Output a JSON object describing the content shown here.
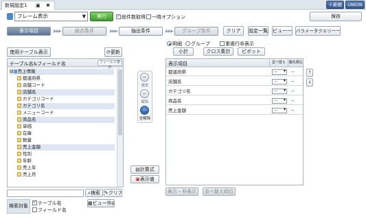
{
  "top_tab": {
    "label": "新規設定1"
  },
  "top_buttons": {
    "new": "＋新規",
    "union": "UNION"
  },
  "toolbar": {
    "view_select": "フレーム表示",
    "run": "実行",
    "total_count": "総件数取得",
    "temp_option": "一時オプション",
    "save": "保存"
  },
  "steps": {
    "display": "表示項目",
    "join": "結合条件",
    "extract": "抽出条件",
    "group": "グループ条件"
  },
  "actions": {
    "clear": "クリア",
    "settings_list": "設定一覧",
    "view_list": "ビュー一覧",
    "param_query": "パラメータクエリー一覧"
  },
  "left": {
    "used_tables": "使用テーブル表示",
    "refresh": "更新",
    "header": "テーブル名&フィールド名",
    "field_display": "フィールド表示",
    "root": "売上情報",
    "fields": [
      "都道府県",
      "店舗コード",
      "店舗名",
      "カテゴリコード",
      "カテゴリ名",
      "メニューコード",
      "商品名",
      "単価",
      "在庫",
      "数量",
      "売上金額",
      "性別",
      "年齢",
      "売上年",
      "売上月"
    ],
    "search_btn": "検索",
    "clear_btn": "クリア",
    "search_target": "検索対象",
    "table_name": "テーブル名",
    "field_name": "フィールド名",
    "view_create": "ビュー作成"
  },
  "middle": {
    "select": "選択",
    "release": "解除",
    "release_all": "全解除",
    "calc": "計算式",
    "display_value": "表示値"
  },
  "right": {
    "mode_detail": "明細",
    "mode_group": "グループ",
    "hide_dup": "重複行非表示",
    "subtotal": "小計",
    "cross": "クロス集計",
    "pivot": "ピボット",
    "col_item": "表示項目",
    "col_sort": "並べ替え",
    "col_priority": "優先順位",
    "rows": [
      {
        "name": "都道府県",
        "sort": "---",
        "priority": "--"
      },
      {
        "name": "店舗名",
        "sort": "---",
        "priority": "--"
      },
      {
        "name": "カテゴリ名",
        "sort": "---",
        "priority": "--"
      },
      {
        "name": "商品名",
        "sort": "---",
        "priority": "--"
      },
      {
        "name": "売上金額",
        "sort": "---",
        "priority": "--"
      }
    ],
    "show_hide": "表示・非表示",
    "sort_order": "並べ替え順位"
  }
}
